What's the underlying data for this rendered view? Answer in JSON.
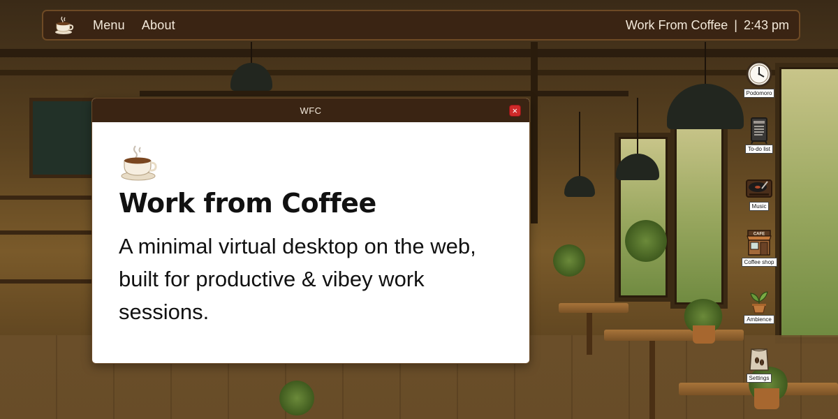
{
  "topbar": {
    "logo_icon": "coffee-cup-icon",
    "menu_label": "Menu",
    "about_label": "About",
    "app_name": "Work From Coffee",
    "separator": "|",
    "time": "2:43 pm"
  },
  "window": {
    "title": "WFC",
    "close_symbol": "×",
    "icon": "coffee-cup-icon",
    "heading": "Work from Coffee",
    "description": "A minimal virtual desktop on the web, built for productive & vibey work sessions."
  },
  "desktop_icons": [
    {
      "label": "Podomoro",
      "icon": "clock-icon"
    },
    {
      "label": "To-do list",
      "icon": "menu-board-icon"
    },
    {
      "label": "Music",
      "icon": "record-player-icon"
    },
    {
      "label": "Coffee shop",
      "icon": "cafe-storefront-icon"
    },
    {
      "label": "Ambience",
      "icon": "potted-plant-icon"
    },
    {
      "label": "Settings",
      "icon": "coffee-bag-icon"
    }
  ],
  "colors": {
    "bar_bg": "#3a2413",
    "bar_border": "#6e4a25",
    "bar_text": "#f4eadb",
    "close_red": "#cf2a2a",
    "window_bg": "#ffffff",
    "text_dark": "#111111"
  }
}
